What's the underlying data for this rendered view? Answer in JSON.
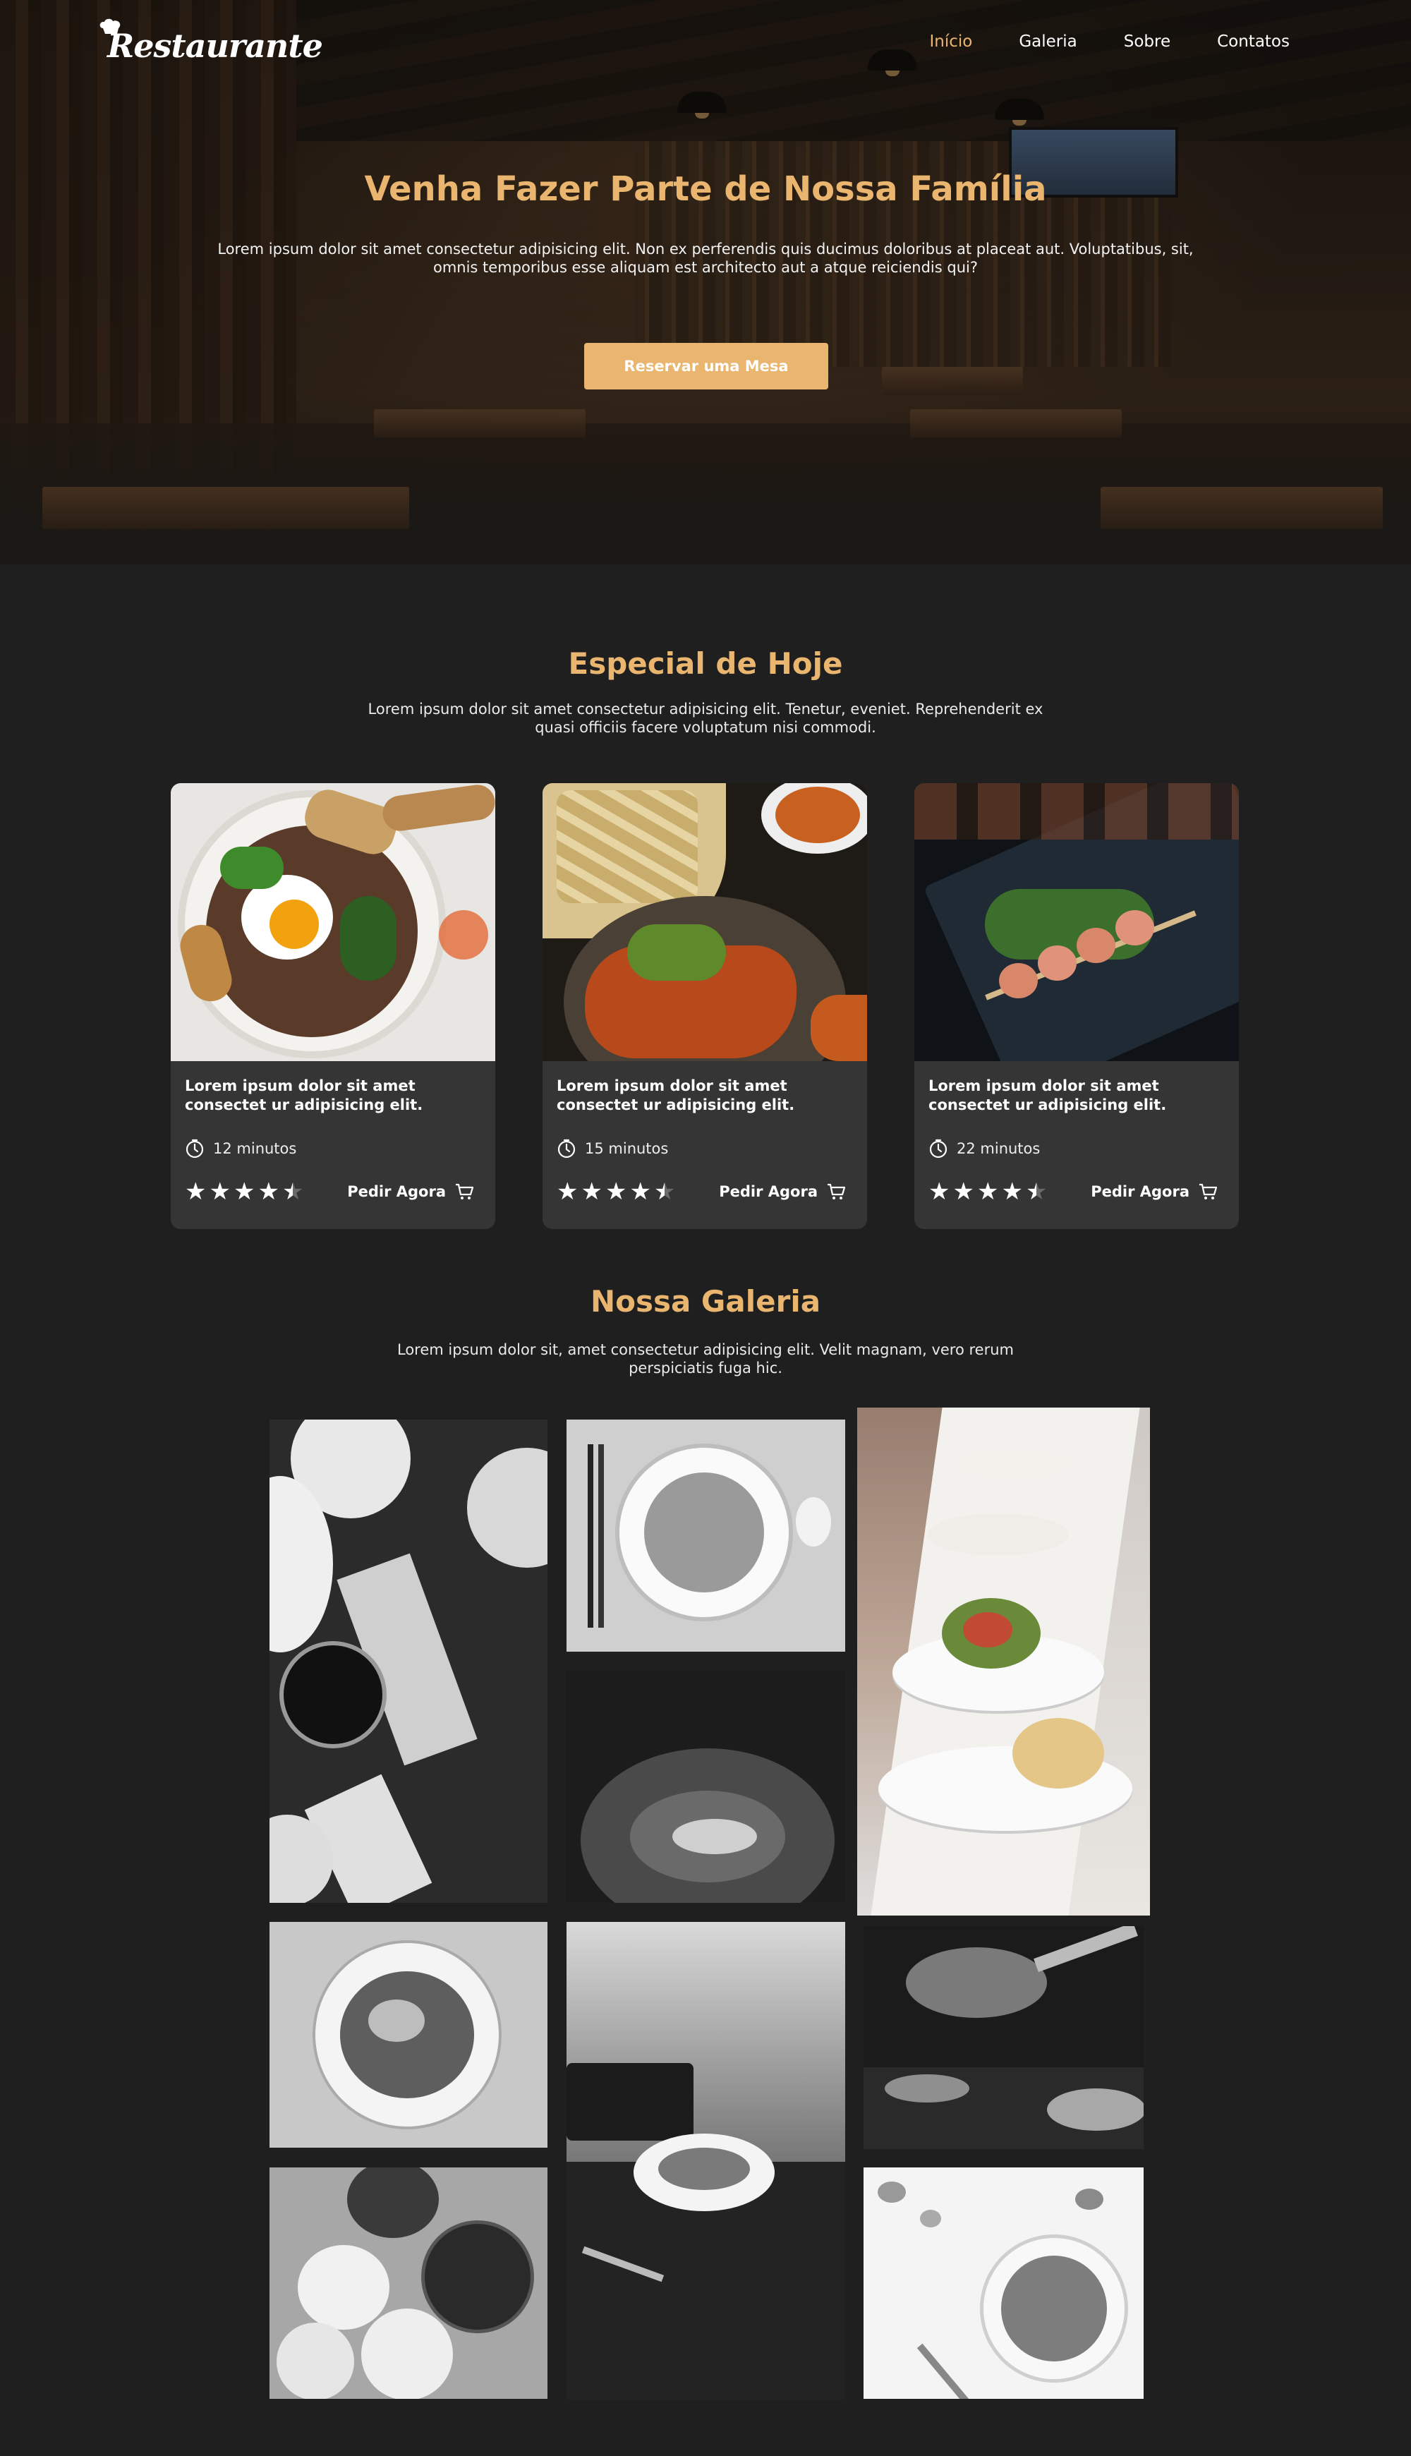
{
  "nav": {
    "logo": "Restaurante",
    "links": [
      "Início",
      "Galeria",
      "Sobre",
      "Contatos"
    ]
  },
  "hero": {
    "title": "Venha Fazer Parte de Nossa Família",
    "text": "Lorem ipsum dolor sit amet consectetur adipisicing elit. Non ex perferendis quis ducimus doloribus at placeat aut. Voluptatibus, sit, omnis temporibus esse aliquam est architecto aut a atque reiciendis qui?",
    "button": "Reservar uma Mesa"
  },
  "special": {
    "title": "Especial de Hoje",
    "subtitle": "Lorem ipsum dolor sit amet consectetur adipisicing elit. Tenetur, eveniet. Reprehenderit ex quasi officiis facere voluptatum nisi commodi.",
    "cards": [
      {
        "title": "Lorem ipsum dolor sit amet consectet ur adipisicing elit.",
        "time": "12 minutos",
        "rating": 4.5,
        "order": "Pedir Agora"
      },
      {
        "title": "Lorem ipsum dolor sit amet consectet ur adipisicing elit.",
        "time": "15 minutos",
        "rating": 4.5,
        "order": "Pedir Agora"
      },
      {
        "title": "Lorem ipsum dolor sit amet consectet ur adipisicing elit.",
        "time": "22 minutos",
        "rating": 4.5,
        "order": "Pedir Agora"
      }
    ]
  },
  "gallery": {
    "title": "Nossa Galeria",
    "subtitle": "Lorem ipsum dolor sit, amet consectetur adipisicing elit. Velit magnam, vero rerum perspiciatis fuga hic."
  },
  "colors": {
    "accent": "#e9b56f",
    "background": "#1f1f1f",
    "card": "#353535"
  }
}
